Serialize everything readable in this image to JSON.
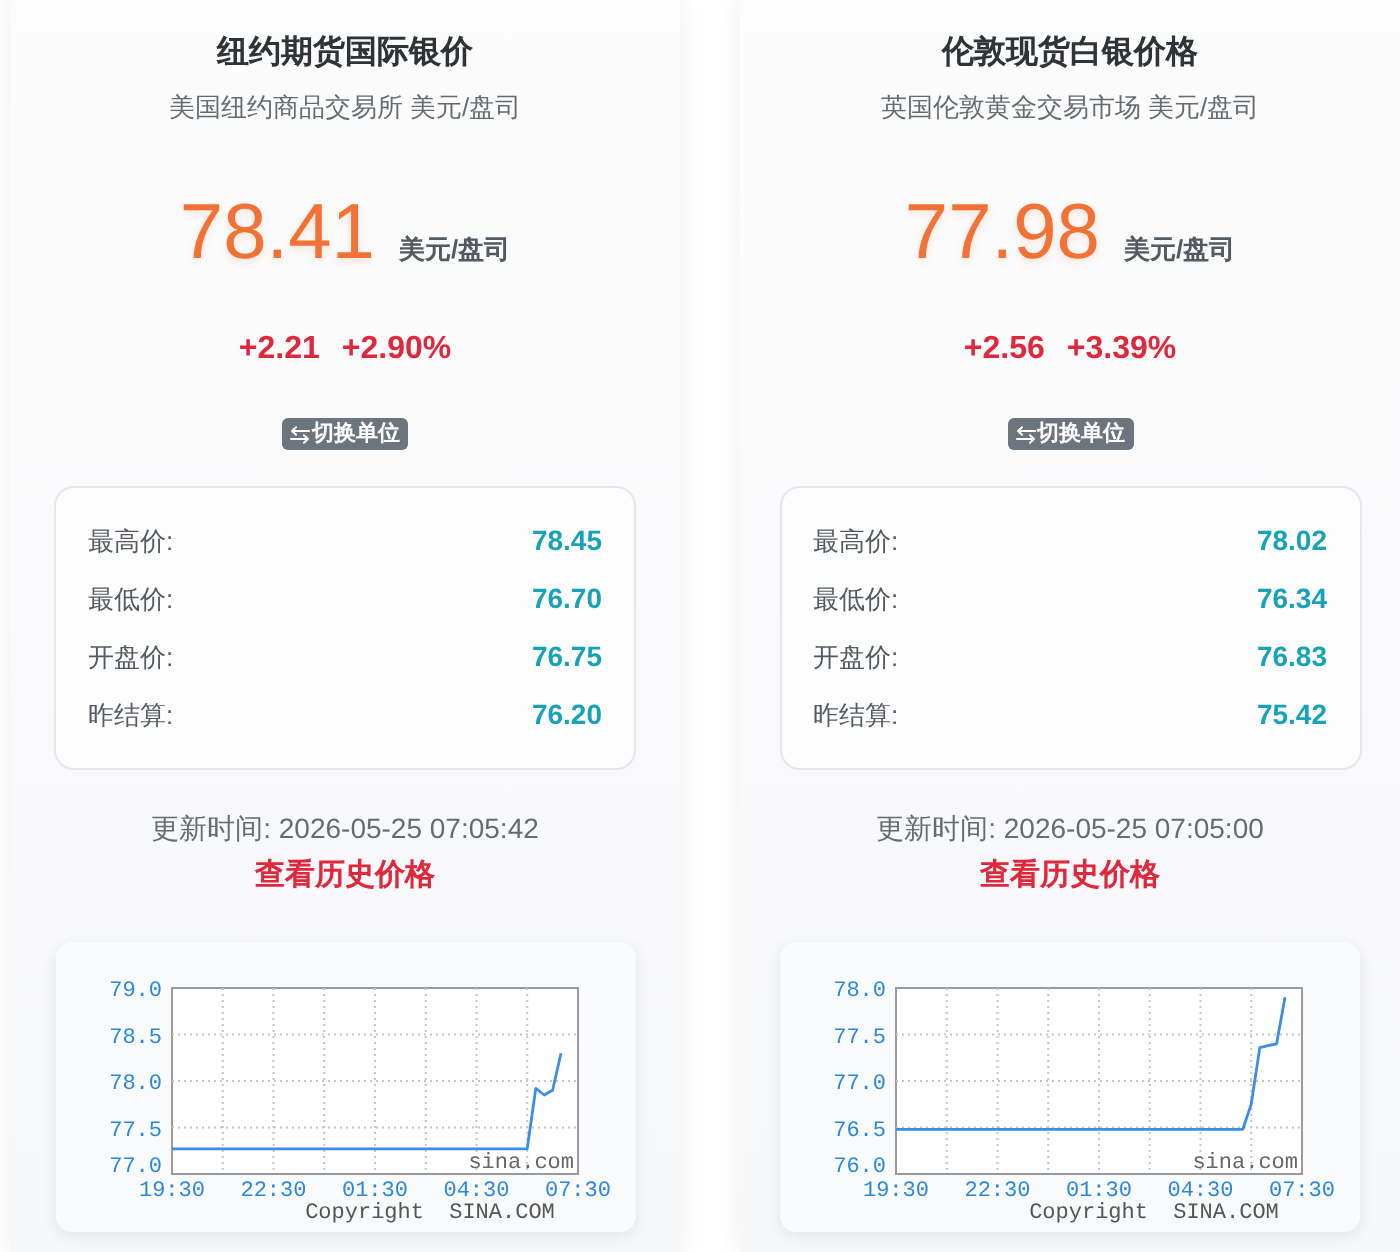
{
  "cards": [
    {
      "title": "纽约期货国际银价",
      "subtitle": "美国纽约商品交易所 美元/盘司",
      "price": "78.41",
      "price_unit": "美元/盘司",
      "change": "+2.21",
      "change_percent": "+2.90%",
      "switch_button": "切换单位",
      "stats": [
        {
          "label": "最高价:",
          "value": "78.45"
        },
        {
          "label": "最低价:",
          "value": "76.70"
        },
        {
          "label": "开盘价:",
          "value": "76.75"
        },
        {
          "label": "昨结算:",
          "value": "76.20"
        }
      ],
      "updated": "更新时间: 2026-05-25 07:05:42",
      "history_link": "查看历史价格",
      "chart": {
        "chart_data": {
          "type": "line",
          "grid": true,
          "categories": [
            "19:30",
            null,
            null,
            null,
            null,
            null,
            null,
            null,
            null,
            null,
            null,
            null,
            "22:30",
            null,
            null,
            null,
            null,
            null,
            null,
            null,
            null,
            null,
            null,
            null,
            "01:30",
            null,
            null,
            null,
            null,
            null,
            null,
            null,
            null,
            null,
            null,
            null,
            "04:30",
            null,
            null,
            null,
            null,
            null,
            null,
            null,
            null,
            null,
            null,
            null,
            "07:30"
          ],
          "series": [
            {
              "color": "#3a8ee6",
              "values": [
                77.27,
                77.27,
                77.27,
                77.27,
                77.27,
                77.27,
                77.27,
                77.27,
                77.27,
                77.27,
                77.27,
                77.27,
                77.27,
                77.27,
                77.27,
                77.27,
                77.27,
                77.27,
                77.27,
                77.27,
                77.27,
                77.27,
                77.27,
                77.27,
                77.27,
                77.27,
                77.27,
                77.27,
                77.27,
                77.27,
                77.27,
                77.27,
                77.27,
                77.27,
                77.27,
                77.27,
                77.27,
                77.27,
                77.27,
                77.27,
                77.27,
                77.27,
                77.27,
                77.92,
                77.85,
                77.9,
                78.3,
                null,
                null
              ]
            }
          ],
          "ylim": [
            77,
            79
          ],
          "yticks": [
            {
              "value": 77,
              "label": "77.0"
            },
            {
              "value": 77.5,
              "label": "77.5"
            },
            {
              "value": 78,
              "label": "78.0"
            },
            {
              "value": 78.5,
              "label": "78.5"
            },
            {
              "value": 79,
              "label": "79.0"
            }
          ]
        },
        "plot_label": "sina.com",
        "copyright": "Copyright SINA.COM"
      }
    },
    {
      "title": "伦敦现货白银价格",
      "subtitle": "英国伦敦黄金交易市场 美元/盘司",
      "price": "77.98",
      "price_unit": "美元/盘司",
      "change": "+2.56",
      "change_percent": "+3.39%",
      "switch_button": "切换单位",
      "stats": [
        {
          "label": "最高价:",
          "value": "78.02"
        },
        {
          "label": "最低价:",
          "value": "76.34"
        },
        {
          "label": "开盘价:",
          "value": "76.83"
        },
        {
          "label": "昨结算:",
          "value": "75.42"
        }
      ],
      "updated": "更新时间: 2026-05-25 07:05:00",
      "history_link": "查看历史价格",
      "chart": {
        "chart_data": {
          "type": "line",
          "grid": true,
          "categories": [
            "19:30",
            null,
            null,
            null,
            null,
            null,
            null,
            null,
            null,
            null,
            null,
            null,
            "22:30",
            null,
            null,
            null,
            null,
            null,
            null,
            null,
            null,
            null,
            null,
            null,
            "01:30",
            null,
            null,
            null,
            null,
            null,
            null,
            null,
            null,
            null,
            null,
            null,
            "04:30",
            null,
            null,
            null,
            null,
            null,
            null,
            null,
            null,
            null,
            null,
            null,
            "07:30"
          ],
          "series": [
            {
              "color": "#3a8ee6",
              "values": [
                76.48,
                76.48,
                76.48,
                76.48,
                76.48,
                76.48,
                76.48,
                76.48,
                76.48,
                76.48,
                76.48,
                76.48,
                76.48,
                76.48,
                76.48,
                76.48,
                76.48,
                76.48,
                76.48,
                76.48,
                76.48,
                76.48,
                76.48,
                76.48,
                76.48,
                76.48,
                76.48,
                76.48,
                76.48,
                76.48,
                76.48,
                76.48,
                76.48,
                76.48,
                76.48,
                76.48,
                76.48,
                76.48,
                76.48,
                76.48,
                76.48,
                76.48,
                76.75,
                77.36,
                77.38,
                77.4,
                77.9,
                null,
                null
              ]
            }
          ],
          "ylim": [
            76,
            78
          ],
          "yticks": [
            {
              "value": 76,
              "label": "76.0"
            },
            {
              "value": 76.5,
              "label": "76.5"
            },
            {
              "value": 77,
              "label": "77.0"
            },
            {
              "value": 77.5,
              "label": "77.5"
            },
            {
              "value": 78,
              "label": "78.0"
            }
          ]
        },
        "plot_label": "sina.com",
        "copyright": "Copyright SINA.COM"
      }
    }
  ]
}
